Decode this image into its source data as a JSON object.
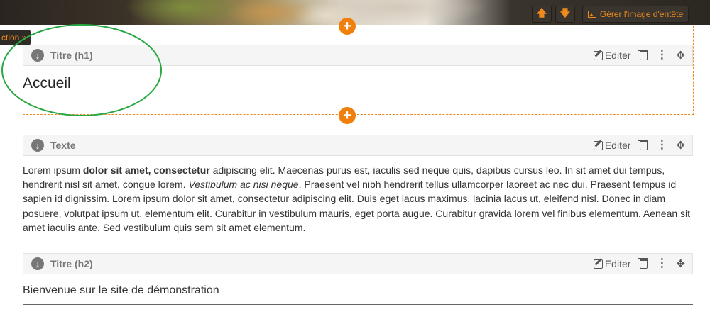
{
  "banner": {
    "move_up_label": "🡅",
    "move_down_label": "🡇",
    "manage_label": "Gérer l'image d'entête"
  },
  "section_tab": {
    "label": "ction »"
  },
  "add_block": {
    "label": "+"
  },
  "blocks": [
    {
      "type": "Titre (h1)",
      "edit": "Editer",
      "content": "Accueil"
    },
    {
      "type": "Texte",
      "edit": "Editer",
      "content": {
        "t1": "Lorem ipsum ",
        "bold": "dolor sit amet, consectetur",
        "t2": " adipiscing elit. Maecenas purus est, iaculis sed neque quis, dapibus cursus leo. In sit amet dui tempus, hendrerit nisl sit amet, congue lorem. ",
        "italic": "Vestibulum ac nisi neque",
        "t3": ". Praesent vel nibh hendrerit tellus ullamcorper laoreet ac nec dui. Praesent tempus id sapien id dignissim. L",
        "underline": "orem ipsum dolor sit amet",
        "t4": ", consectetur adipiscing elit. Duis eget lacus maximus, lacinia lacus ut, eleifend nisl. Donec in diam posuere, volutpat ipsum ut, elementum elit. Curabitur in vestibulum mauris, eget porta augue. Curabitur gravida lorem vel finibus elementum. Aenean sit amet iaculis ante. Sed vestibulum quis sem sit amet elementum."
      }
    },
    {
      "type": "Titre (h2)",
      "edit": "Editer",
      "content": "Bienvenue sur le site de démonstration"
    }
  ],
  "icons": {
    "collapse": "chevron-down-circle-icon",
    "edit": "pencil-square-icon",
    "delete": "trash-icon",
    "more": "vertical-dots-icon",
    "move": "move-arrows-icon",
    "image": "image-icon"
  },
  "colors": {
    "accent": "#f07f0c",
    "annotation": "#2aa844",
    "bar_bg": "#f5f5f5"
  }
}
